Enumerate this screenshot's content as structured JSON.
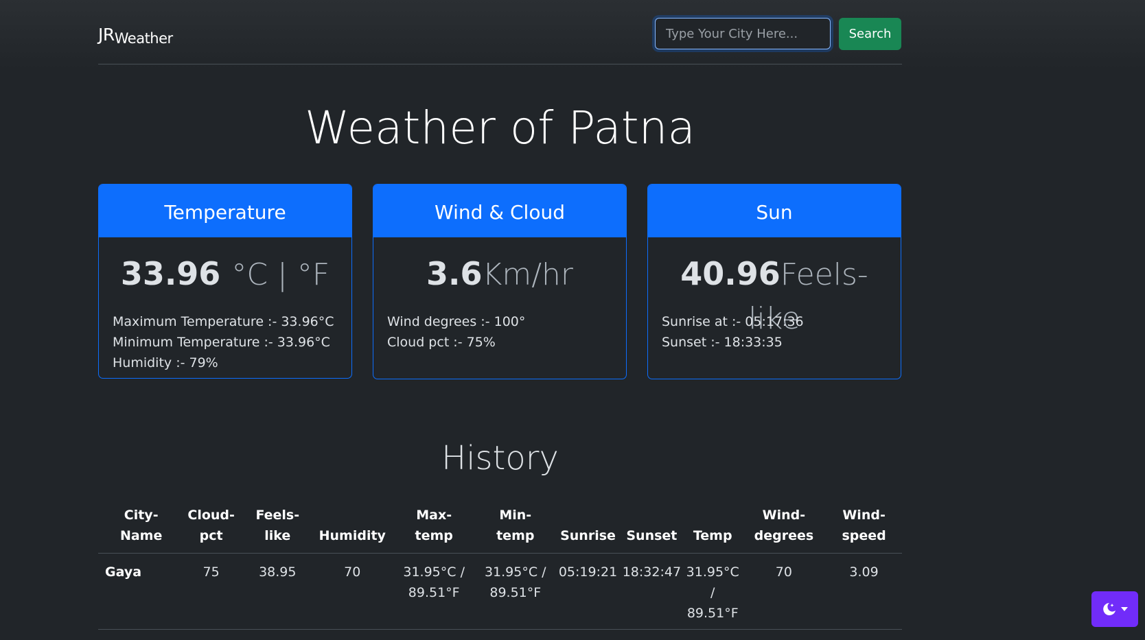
{
  "brand": {
    "main": "JR",
    "sub": "Weather"
  },
  "search": {
    "placeholder": "Type Your City Here...",
    "button_label": "Search"
  },
  "page_title": "Weather of Patna",
  "cards": {
    "temperature": {
      "header": "Temperature",
      "value": "33.96",
      "unit": "°C | °F",
      "lines": [
        "Maximum Temperature :- 33.96°C",
        "Minimum Temperature :- 33.96°C",
        "Humidity :- 79%"
      ]
    },
    "wind": {
      "header": "Wind & Cloud",
      "value": "3.6",
      "unit": "Km/hr",
      "lines": [
        "Wind degrees :- 100°",
        "Cloud pct :- 75%"
      ]
    },
    "sun": {
      "header": "Sun",
      "value": "40.96",
      "unit": "Feels-like",
      "lines": [
        "Sunrise at :- 05:17:36",
        "Sunset :- 18:33:35"
      ]
    }
  },
  "history": {
    "title": "History",
    "columns": [
      "City-Name",
      "Cloud-pct",
      "Feels-like",
      "Humidity",
      "Max-temp",
      "Min-temp",
      "Sunrise",
      "Sunset",
      "Temp",
      "Wind-degrees",
      "Wind-speed"
    ],
    "rows": [
      {
        "city": "Gaya",
        "cloud_pct": "75",
        "feels_like": "38.95",
        "humidity": "70",
        "max_temp": "31.95°C / 89.51°F",
        "min_temp": "31.95°C / 89.51°F",
        "sunrise": "05:19:21",
        "sunset": "18:32:47",
        "temp": "31.95°C / 89.51°F",
        "wind_degrees": "70",
        "wind_speed": "3.09"
      }
    ]
  },
  "theme_toggle": {
    "icon": "moon-stars-icon",
    "accent": "#712cf9"
  },
  "colors": {
    "primary": "#0d6efd",
    "success": "#198754",
    "background": "#212529"
  }
}
